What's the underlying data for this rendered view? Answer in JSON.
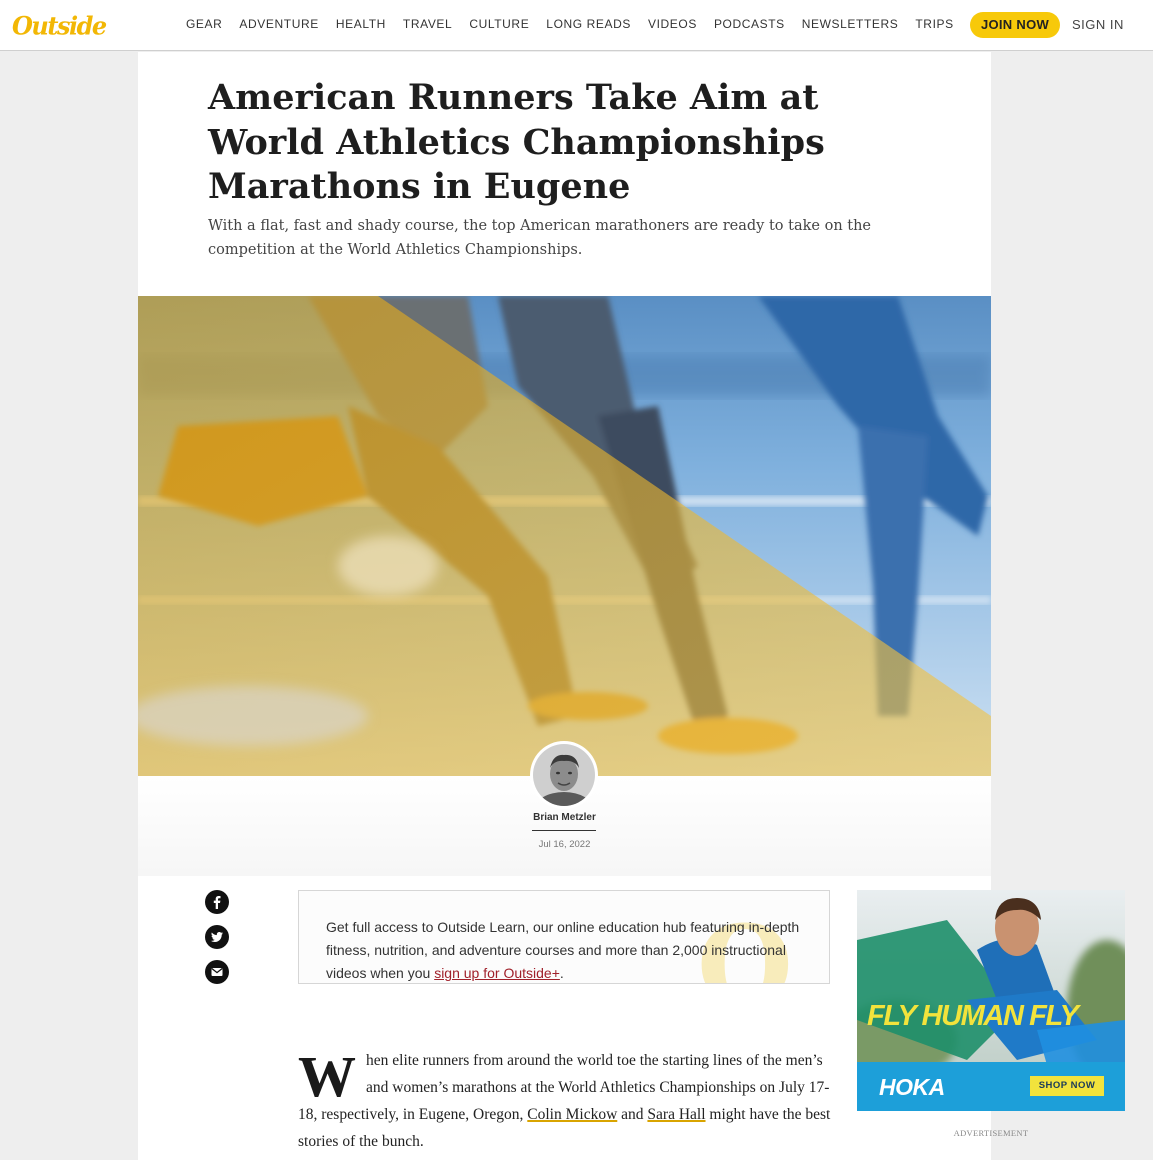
{
  "brand": {
    "logo_text": "Outside",
    "logo_color": "#f2b705"
  },
  "nav": {
    "items": [
      {
        "label": "GEAR"
      },
      {
        "label": "ADVENTURE"
      },
      {
        "label": "HEALTH"
      },
      {
        "label": "TRAVEL"
      },
      {
        "label": "CULTURE"
      },
      {
        "label": "LONG READS"
      },
      {
        "label": "VIDEOS"
      },
      {
        "label": "PODCASTS"
      },
      {
        "label": "NEWSLETTERS"
      },
      {
        "label": "TRIPS"
      }
    ],
    "join_label": "JOIN NOW",
    "join_color": "#f7c90a",
    "signin_label": "SIGN IN"
  },
  "article": {
    "headline": "American Runners Take Aim at World Athletics Championships Marathons in Eugene",
    "dek": "With a flat, fast and shady course, the top American marathoners are ready to take on the competition at the World Athletics Championships.",
    "hero_icon": "runners-photo",
    "author": "Brian Metzler",
    "date": "Jul 16, 2022",
    "share": [
      {
        "icon": "facebook-icon"
      },
      {
        "icon": "twitter-icon"
      },
      {
        "icon": "email-icon"
      }
    ],
    "promo": {
      "text_before": "Get full access to Outside Learn, our online education hub featuring in-depth fitness, nutrition, and adventure courses and more than 2,000 instructional videos when you ",
      "link": "sign up for Outside+",
      "text_after": ".",
      "watermark": "O"
    },
    "body": {
      "dropcap": "W",
      "text_1": "hen elite runners from around the world toe the starting lines of the men’s and women’s marathons at the World Athletics Championships on July 17-18, respectively, in Eugene, Oregon, ",
      "link_1": "Colin Mickow",
      "text_2": " and ",
      "link_2": "Sara Hall",
      "text_3": " might have the best stories of the bunch."
    }
  },
  "ad": {
    "headline": "FLY HUMAN FLY",
    "brand": "HOKA",
    "cta": "SHOP NOW",
    "label": "ADVERTISEMENT",
    "accent": "#f2e33c"
  }
}
